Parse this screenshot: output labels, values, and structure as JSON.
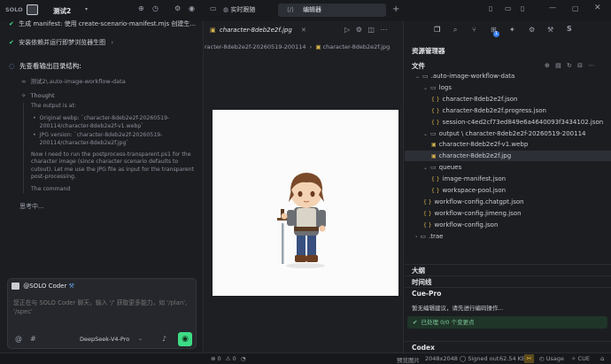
{
  "titlebar": {
    "solo_label": "SOLO",
    "project_name": "测试2",
    "tab_live": "实时跟随",
    "tab_editor": "编辑器",
    "new_tab": "+",
    "notify_count": "1"
  },
  "chat": {
    "item1": "生成 manifest: 使用 create-scenario-manifest.mjs 创建生...",
    "item2": "安装依赖并运行即梦浏览器生图",
    "item3": "先查看输出目录结构:",
    "path_line": "测试2\\.auto-image-workflow-data",
    "thought_title": "Thought",
    "thought_output": "The output is at:",
    "bullet1": "Original webp: `character-8deb2e2f-20260519-200114/character-8deb2e2f-v1.webp`",
    "bullet2": "JPG version: `character-8deb2e2f-20260519-200114/character-8deb2e2f.jpg`",
    "para": "Now I need to run the postprocess-transparent.ps1 for the character image (since character scenario defaults to cutout). Let me use the JPG file as input for the transparent post-processing.",
    "command": "The command",
    "thinking": "思考中..."
  },
  "composer": {
    "agent": "@SOLO Coder",
    "placeholder": "您正在与 SOLO Coder 聊天，输入 '/' 获取更多能力，如 '/plan', '/spec'",
    "model": "DeepSeek-V4-Pro"
  },
  "editor": {
    "file_tab": "character-8deb2e2f.jpg",
    "breadcrumb_1": "racter-8deb2e2f-20260519-200114",
    "breadcrumb_2": "character-8deb2e2f.jpg"
  },
  "explorer": {
    "title": "资源管理器",
    "files_label": "文件",
    "tree": [
      {
        "label": ".auto-image-workflow-data",
        "kind": "folder-open",
        "depth": 0
      },
      {
        "label": "logs",
        "kind": "folder-open",
        "depth": 1
      },
      {
        "label": "character-8deb2e2f.json",
        "kind": "json",
        "depth": 2
      },
      {
        "label": "character-8deb2e2f.progress.json",
        "kind": "json",
        "depth": 2
      },
      {
        "label": "session-c4ed2cf73ed849e6a4640093f3434102.json",
        "kind": "json",
        "depth": 2
      },
      {
        "label": "output \\ character-8deb2e2f-20260519-200114",
        "kind": "folder-open",
        "depth": 1
      },
      {
        "label": "character-8deb2e2f-v1.webp",
        "kind": "img",
        "depth": 2
      },
      {
        "label": "character-8deb2e2f.jpg",
        "kind": "img",
        "depth": 2,
        "selected": true
      },
      {
        "label": "queues",
        "kind": "folder-open",
        "depth": 1
      },
      {
        "label": "image-manifest.json",
        "kind": "json",
        "depth": 2
      },
      {
        "label": "workspace-pool.json",
        "kind": "json",
        "depth": 2
      },
      {
        "label": "workflow-config.chatgpt.json",
        "kind": "json",
        "depth": 1
      },
      {
        "label": "workflow-config.jimeng.json",
        "kind": "json",
        "depth": 1
      },
      {
        "label": "workflow-config.json",
        "kind": "json",
        "depth": 1
      },
      {
        "label": ".trae",
        "kind": "folder",
        "depth": 0
      }
    ],
    "outline": "大纲",
    "timeline": "时间线",
    "cue_pro": "Cue-Pro",
    "cue_msg": "暂无编辑建议，请先进行编码操作...",
    "cue_status": "已处理 0/0 个变更点",
    "codex": "Codex"
  },
  "statusbar": {
    "errors": "0",
    "warnings": "0",
    "preview": "预览图片",
    "dimensions": "2048x2048",
    "signed_out": "Signed out",
    "size": "62.54 KB",
    "usage": "Usage",
    "cue": "CUE"
  },
  "colors": {
    "accent_green": "#3ddc84",
    "selection": "#2c2f36",
    "json_icon": "#d6b34a"
  }
}
